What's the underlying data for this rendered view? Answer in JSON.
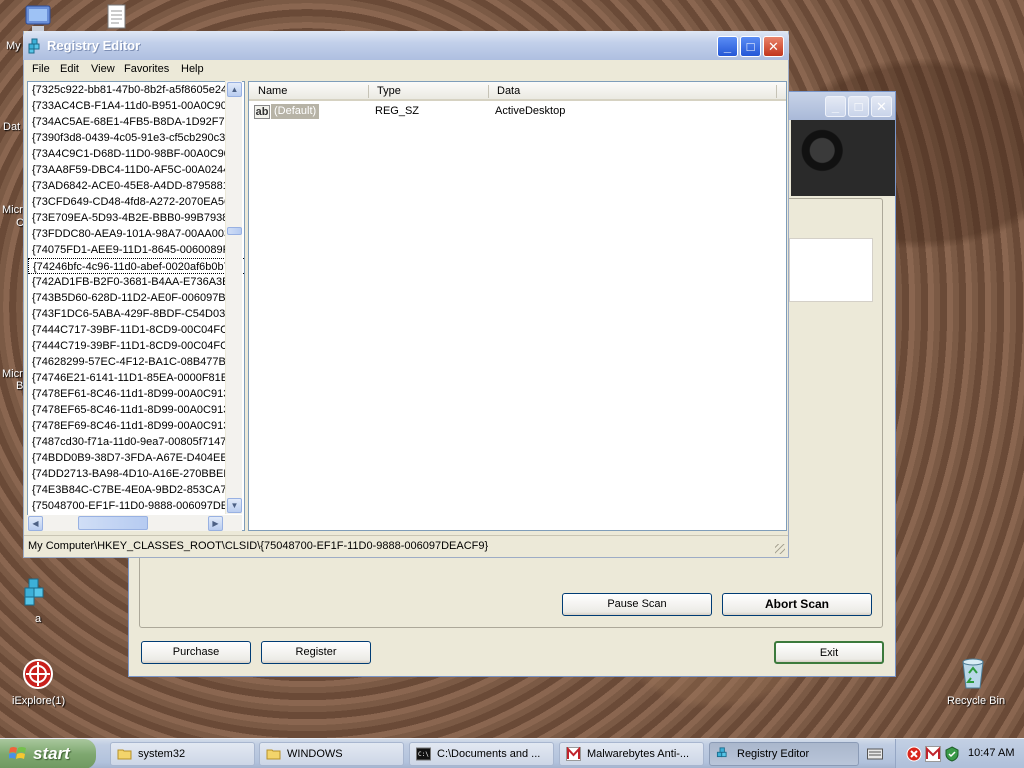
{
  "desktop": {
    "icons": [
      {
        "label": "My"
      },
      {
        "label": "Dat"
      },
      {
        "label": "Micr"
      },
      {
        "label": "C"
      },
      {
        "label": "Micr"
      },
      {
        "label": "B"
      },
      {
        "label": "a"
      },
      {
        "label": "iExplore(1)"
      },
      {
        "label": "Recycle Bin"
      }
    ]
  },
  "scanner": {
    "buttons": {
      "pause": "Pause Scan",
      "abort": "Abort Scan",
      "purchase": "Purchase",
      "register": "Register",
      "exit": "Exit"
    }
  },
  "regedit": {
    "title": "Registry Editor",
    "menu": [
      "File",
      "Edit",
      "View",
      "Favorites",
      "Help"
    ],
    "tree_items": [
      "{7325c922-bb81-47b0-8b2f-a5f8605e24",
      "{733AC4CB-F1A4-11d0-B951-00A0C903",
      "{734AC5AE-68E1-4FB5-B8DA-1D92F7FC",
      "{7390f3d8-0439-4c05-91e3-cf5cb290c3",
      "{73A4C9C1-D68D-11D0-98BF-00A0C90I",
      "{73AA8F59-DBC4-11D0-AF5C-00A02448",
      "{73AD6842-ACE0-45E8-A4DD-87958814",
      "{73CFD649-CD48-4fd8-A272-2070EA56",
      "{73E709EA-5D93-4B2E-BBB0-99B7938D",
      "{73FDDC80-AEA9-101A-98A7-00AA0037",
      "{74075FD1-AEE9-11D1-8645-0060089F",
      "{74246bfc-4c96-11d0-abef-0020af6b0b7a}",
      "{742AD1FB-B2F0-3681-B4AA-E736A3BC",
      "{743B5D60-628D-11D2-AE0F-006097B0",
      "{743F1DC6-5ABA-429F-8BDF-C54D0325",
      "{7444C717-39BF-11D1-8CD9-00C04FC2",
      "{7444C719-39BF-11D1-8CD9-00C04FC2",
      "{74628299-57EC-4F12-BA1C-08B477BF",
      "{74746E21-6141-11D1-85EA-0000F81E",
      "{7478EF61-8C46-11d1-8D99-00A0C913",
      "{7478EF65-8C46-11d1-8D99-00A0C913",
      "{7478EF69-8C46-11d1-8D99-00A0C913",
      "{7487cd30-f71a-11d0-9ea7-00805f7147",
      "{74BDD0B9-38D7-3FDA-A67E-D404EE6",
      "{74DD2713-BA98-4D10-A16E-270BBEB9",
      "{74E3B84C-C7BE-4E0A-9BD2-853CA72",
      "{75048700-EF1F-11D0-9888-006097DE"
    ],
    "selected_index": 11,
    "columns": {
      "name": "Name",
      "type": "Type",
      "data": "Data"
    },
    "values": [
      {
        "name": "(Default)",
        "type": "REG_SZ",
        "data": "ActiveDesktop"
      }
    ],
    "status": "My Computer\\HKEY_CLASSES_ROOT\\CLSID\\{75048700-EF1F-11D0-9888-006097DEACF9}"
  },
  "taskbar": {
    "start": "start",
    "tasks": [
      {
        "label": "system32"
      },
      {
        "label": "WINDOWS"
      },
      {
        "label": "C:\\Documents and ..."
      },
      {
        "label": "Malwarebytes Anti-..."
      },
      {
        "label": "Registry Editor"
      }
    ],
    "clock": "10:47 AM"
  }
}
